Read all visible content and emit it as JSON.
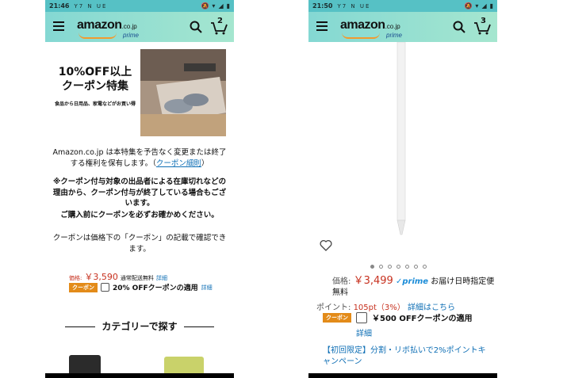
{
  "left": {
    "status": {
      "time": "21:46",
      "notifications": "Y7 N UE",
      "battery": ""
    },
    "appbar": {
      "logo": "amazon",
      "logo_tld": ".co.jp",
      "logo_sub": "prime",
      "cart_count": "2"
    },
    "banner": {
      "line1": "10%OFF以上",
      "line2": "クーポン特集",
      "line3": "食品から日用品、家電などがお買い得"
    },
    "notice": {
      "text": "Amazon.co.jp は本特集を予告なく変更または終了する権利を保有します。（",
      "link": "クーポン細則",
      "close": "）"
    },
    "warning": "※クーポン付与対象の出品者による在庫切れなどの理由から、クーポン付与が終了している場合もございます。",
    "confirm": "ご購入前にクーポンを必ずお確かめください。",
    "info": "クーポンは価格下の「クーポン」の記載で確認できます。",
    "price_row": {
      "label": "価格:",
      "price": "￥3,590",
      "shipping": "通常配送無料",
      "detail": "詳細"
    },
    "coupon_row": {
      "badge": "クーポン",
      "text": "20% OFFクーポンの適用",
      "detail": "詳細"
    },
    "category_heading": "カテゴリーで探す"
  },
  "right": {
    "status": {
      "time": "21:50",
      "notifications": "Y7 N UE"
    },
    "appbar": {
      "logo": "amazon",
      "logo_tld": ".co.jp",
      "logo_sub": "prime",
      "cart_count": "3"
    },
    "carousel": {
      "pages": 7,
      "active": 1
    },
    "price": {
      "label": "価格:",
      "value": "￥3,499",
      "prime": "✓prime",
      "delivery": "お届け日時指定便 無料"
    },
    "points": {
      "label": "ポイント:",
      "value": "105pt（3%）",
      "link": "詳細はこちら"
    },
    "coupon": {
      "badge": "クーポン",
      "text": "￥500 OFFクーポンの適用",
      "detail": "詳細"
    },
    "promo": "【初回限定】分割・リボ払いで2%ポイントキャンペーン"
  },
  "colors": {
    "accent_teal": "#56c1c5",
    "price_red": "#c7311f",
    "link_blue": "#0f6fb5",
    "coupon_orange": "#e38b19"
  }
}
